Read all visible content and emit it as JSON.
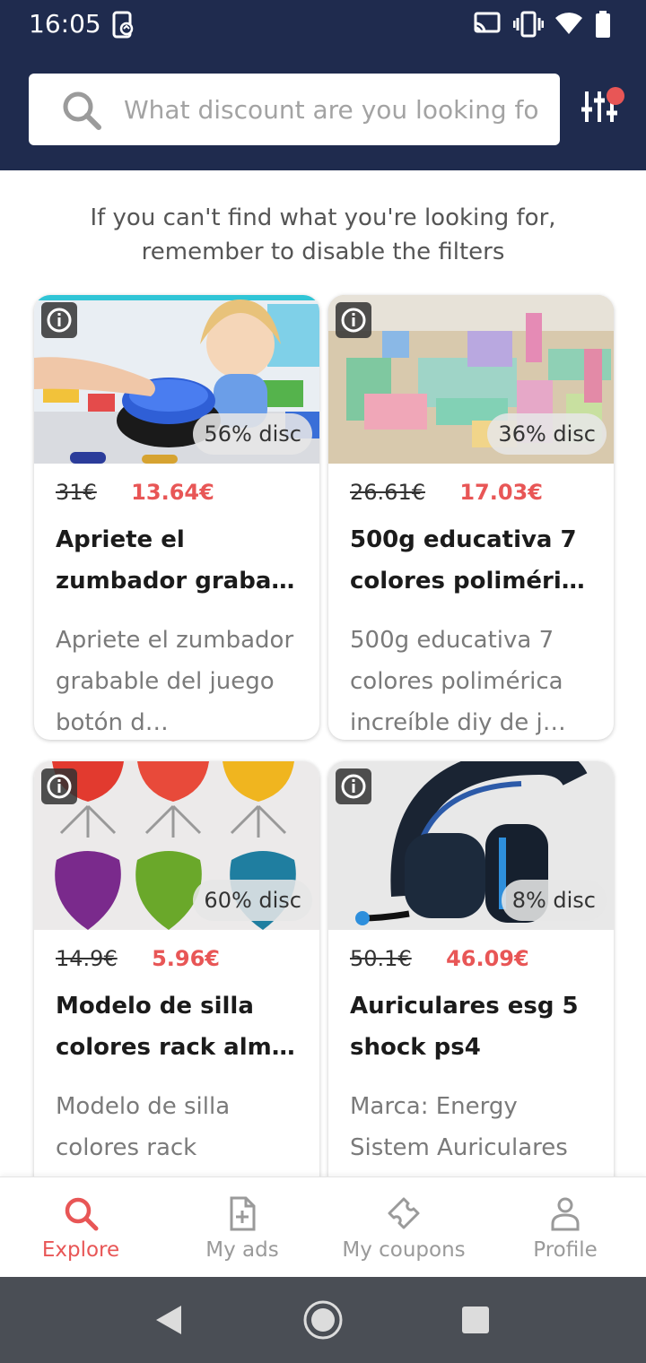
{
  "status_bar": {
    "time": "16:05",
    "icons": [
      "phone-sync-icon",
      "cast-icon",
      "vibrate-icon",
      "wifi-icon",
      "battery-icon"
    ]
  },
  "search": {
    "placeholder": "What discount are you looking fo",
    "value": ""
  },
  "info_text": "If you can't find what you're looking for, remember to disable the filters",
  "products": [
    {
      "discount": "56% disc",
      "old_price": "31€",
      "new_price": "13.64€",
      "title": "Apriete el zumbador graba…",
      "description": "Apriete el zumbador grabable del juego botón d…"
    },
    {
      "discount": "36% disc",
      "old_price": "26.61€",
      "new_price": "17.03€",
      "title": "500g educativa 7 colores poliméri…",
      "description": "500g educativa 7 colores polimérica increíble diy de j…"
    },
    {
      "discount": "60% disc",
      "old_price": "14.9€",
      "new_price": "5.96€",
      "title": "Modelo de silla colores rack alm…",
      "description": "Modelo de silla colores rack"
    },
    {
      "discount": "8% disc",
      "old_price": "50.1€",
      "new_price": "46.09€",
      "title": "Auriculares esg 5 shock ps4",
      "description": "Marca: Energy Sistem  Auriculares"
    }
  ],
  "bottom_nav": {
    "active": "explore",
    "items": [
      {
        "label": "Explore",
        "icon": "search-icon"
      },
      {
        "label": "My ads",
        "icon": "add-document-icon"
      },
      {
        "label": "My coupons",
        "icon": "coupon-icon"
      },
      {
        "label": "Profile",
        "icon": "user-icon"
      }
    ]
  },
  "colors": {
    "header": "#1f2b4e",
    "accent": "#e85656",
    "inactive": "#9a9a9a",
    "android_nav": "#4a4e55"
  }
}
